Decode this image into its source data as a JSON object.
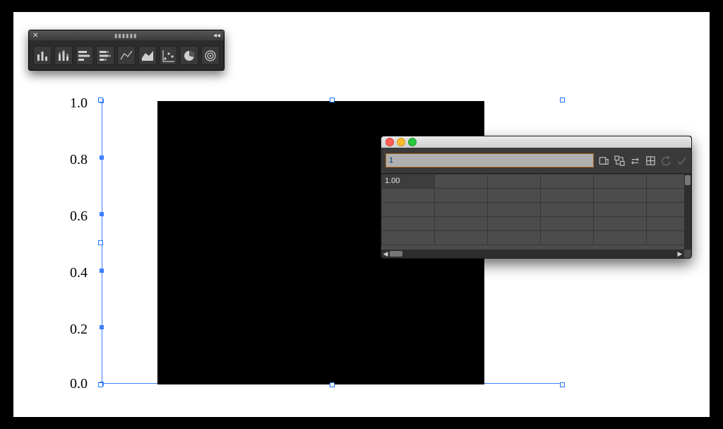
{
  "chart_data": {
    "type": "bar",
    "categories": [
      ""
    ],
    "values": [
      1.0
    ],
    "ylim": [
      0.0,
      1.0
    ]
  },
  "axis": {
    "ticks": [
      "1.0",
      "0.8",
      "0.6",
      "0.4",
      "0.2",
      "0.0"
    ]
  },
  "palette": {
    "tooltips": [
      "column-chart",
      "stacked-column-chart",
      "bar-chart",
      "stacked-bar-chart",
      "line-chart",
      "area-chart",
      "scatter-chart",
      "pie-chart",
      "radar-chart"
    ]
  },
  "data_window": {
    "entry_value": "1",
    "toolbar_icons": [
      "import-data",
      "transpose",
      "switch-xy",
      "cell-style",
      "revert",
      "apply"
    ],
    "cell_value": "1.00",
    "columns": 6,
    "rows": 5
  },
  "colors": {
    "selection": "#1e74ff",
    "entry_border": "#b0671f"
  }
}
